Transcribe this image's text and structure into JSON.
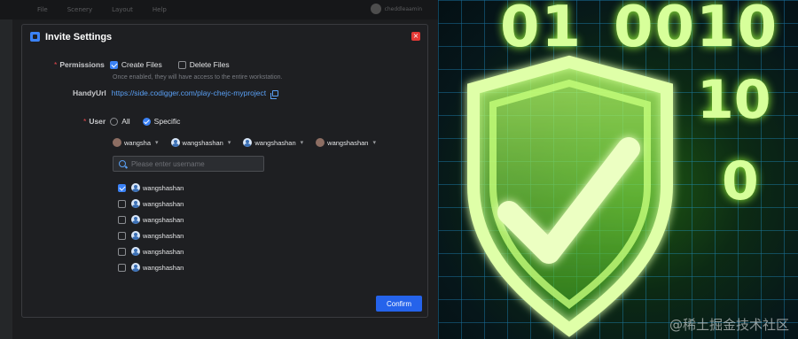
{
  "editor": {
    "menu": [
      "File",
      "Scenery",
      "Layout",
      "Help"
    ],
    "user": "cheddleaamin"
  },
  "dialog": {
    "title": "Invite Settings",
    "close_glyph": "×",
    "permissions": {
      "label": "Permissions",
      "options": [
        {
          "label": "Create Files",
          "checked": true
        },
        {
          "label": "Delete Files",
          "checked": false
        }
      ],
      "hint": "Once enabled, they will have access to the entire workstation."
    },
    "handyurl": {
      "label": "HandyUrl",
      "value": "https://side.codigger.com/play-chejc-myproject"
    },
    "user": {
      "label": "User",
      "options": [
        {
          "label": "All",
          "selected": false
        },
        {
          "label": "Specific",
          "selected": true
        }
      ]
    },
    "selected_users": [
      {
        "name": "wangsha",
        "avatar": "photo"
      },
      {
        "name": "wangshashan",
        "avatar": "user"
      },
      {
        "name": "wangshashan",
        "avatar": "user"
      },
      {
        "name": "wangshashan",
        "avatar": "photo"
      }
    ],
    "chip_remove_glyph": "▾",
    "search": {
      "placeholder": "Please enter username"
    },
    "user_list": [
      {
        "name": "wangshashan",
        "checked": true
      },
      {
        "name": "wangshashan",
        "checked": false
      },
      {
        "name": "wangshashan",
        "checked": false
      },
      {
        "name": "wangshashan",
        "checked": false
      },
      {
        "name": "wangshashan",
        "checked": false
      },
      {
        "name": "wangshashan",
        "checked": false
      }
    ],
    "confirm_label": "Confirm"
  },
  "artwork": {
    "digits": [
      "01",
      "0010",
      "10",
      "0"
    ],
    "watermark": "@稀土掘金技术社区"
  },
  "colors": {
    "accent": "#3b82f6",
    "close": "#e53935",
    "required": "#e5484d",
    "link": "#5aa0f5"
  }
}
